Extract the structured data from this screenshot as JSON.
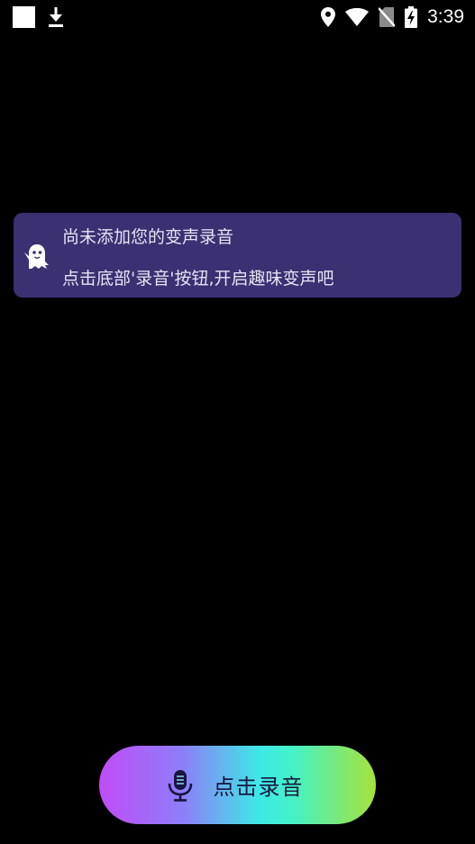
{
  "status_bar": {
    "time": "3:39",
    "left_icons": [
      "app-square-icon",
      "download-icon"
    ],
    "right_icons": [
      "location-icon",
      "wifi-icon",
      "no-sim-icon",
      "battery-charging-icon"
    ]
  },
  "empty_state": {
    "icon": "ghost-icon",
    "title": "尚未添加您的变声录音",
    "subtitle": "点击底部'录音'按钮,开启趣味变声吧",
    "background": "#3a3072"
  },
  "record_button": {
    "icon": "microphone-icon",
    "label": "点击录音"
  }
}
